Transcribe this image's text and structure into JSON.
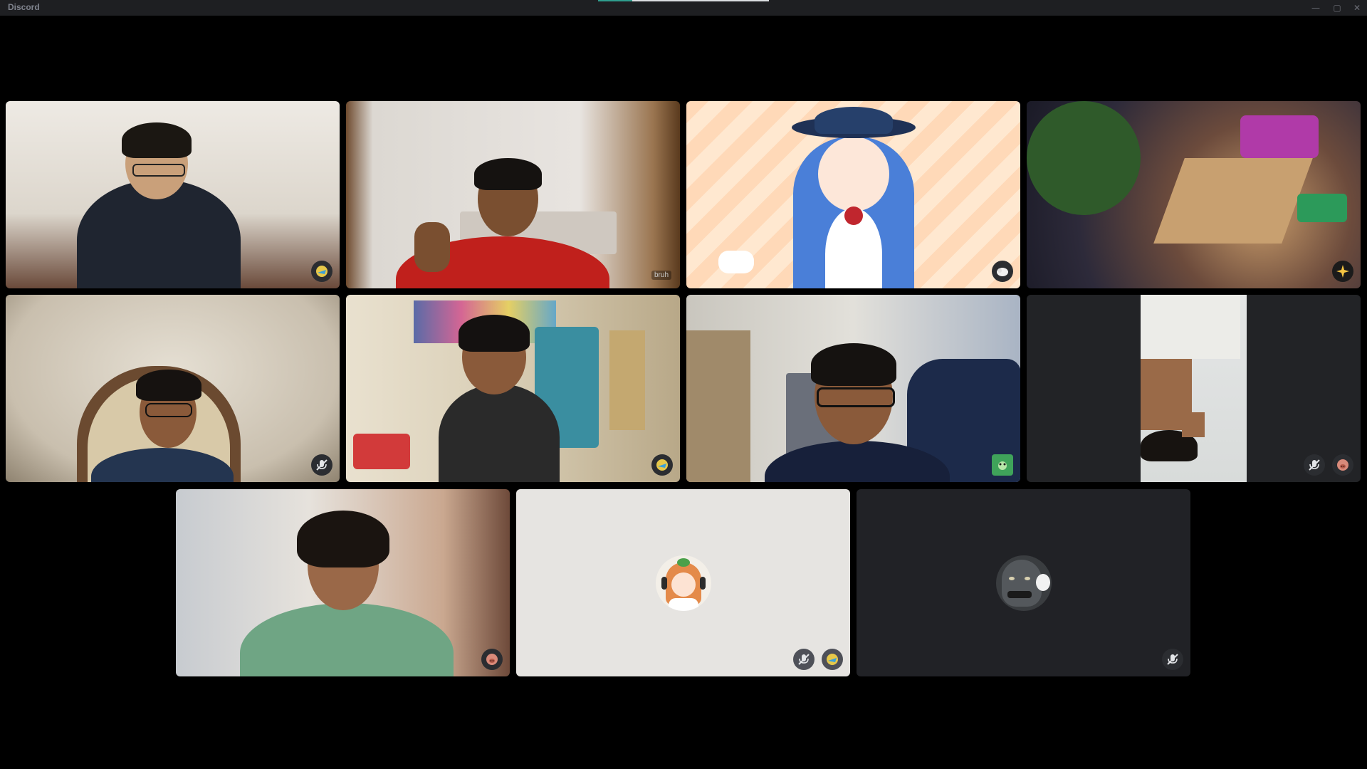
{
  "window": {
    "title": "Discord",
    "controls": {
      "minimize": "—",
      "maximize": "▢",
      "close": "✕"
    }
  },
  "tiles": [
    {
      "id": 1,
      "type": "video",
      "muted": false,
      "badge_icons": [
        "crest-icon"
      ]
    },
    {
      "id": 2,
      "type": "video",
      "muted": false,
      "name_tag": "bruh"
    },
    {
      "id": 3,
      "type": "video",
      "muted": false,
      "badge_icons": [
        "sheep-icon"
      ]
    },
    {
      "id": 4,
      "type": "video",
      "muted": false,
      "badge_icons": [
        "sparkle-icon"
      ]
    },
    {
      "id": 5,
      "type": "video",
      "muted": true,
      "badge_icons": [
        "mic-muted-icon"
      ]
    },
    {
      "id": 6,
      "type": "video",
      "muted": false,
      "badge_icons": [
        "crest-icon"
      ]
    },
    {
      "id": 7,
      "type": "video",
      "muted": false,
      "badge_icons": [
        "frog-icon"
      ]
    },
    {
      "id": 8,
      "type": "video",
      "muted": true,
      "badge_icons": [
        "mic-muted-icon",
        "pig-icon"
      ]
    },
    {
      "id": 9,
      "type": "video",
      "muted": false,
      "badge_icons": [
        "pig-icon"
      ]
    },
    {
      "id": 10,
      "type": "avatar",
      "muted": true,
      "avatar": "anime-girl-headset-avatar",
      "badge_icons": [
        "mic-muted-icon",
        "crest-icon"
      ]
    },
    {
      "id": 11,
      "type": "avatar",
      "muted": true,
      "avatar": "godzilla-avatar",
      "badge_icons": [
        "mic-muted-icon"
      ]
    }
  ],
  "colors": {
    "background": "#000000",
    "titlebar": "#1e1f22",
    "badge_bg": "#2b2d31",
    "progress_accent": "#2f9e8e"
  }
}
